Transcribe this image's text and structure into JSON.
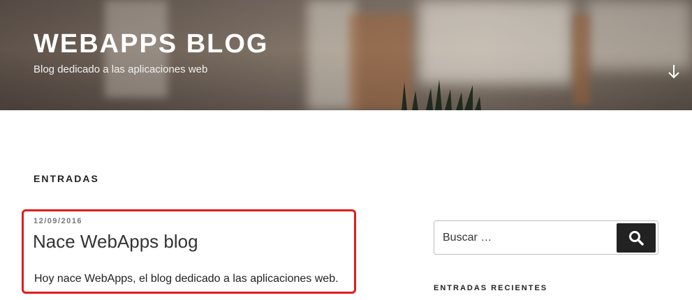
{
  "header": {
    "site_title": "WEBAPPS BLOG",
    "site_description": "Blog dedicado a las aplicaciones web",
    "scroll_down_icon": "arrow-down-icon"
  },
  "main": {
    "page_header": "ENTRADAS",
    "posts": [
      {
        "date": "12/09/2016",
        "title": "Nace WebApps blog",
        "excerpt": "Hoy nace WebApps, el blog dedicado a las aplicaciones web."
      }
    ],
    "highlight_color": "#e21b1b"
  },
  "sidebar": {
    "search": {
      "placeholder": "Buscar …",
      "button_icon": "search-icon"
    },
    "recent_posts_title": "ENTRADAS RECIENTES"
  }
}
